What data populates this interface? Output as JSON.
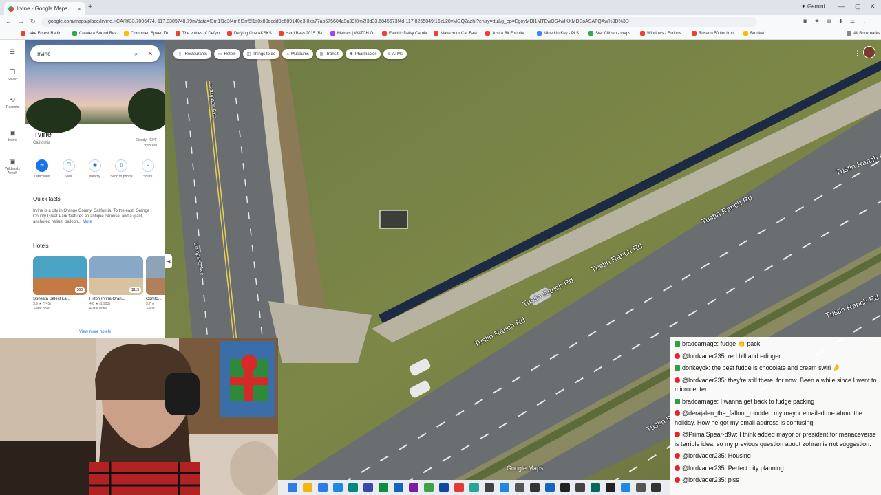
{
  "browser": {
    "tab_title": "Irvine - Google Maps",
    "new_tab_glyph": "+",
    "gemini": "Gemini",
    "url": "google.com/maps/place/Irvine,+CA/@33.7006474,-117.8309748,79m/data=!3m1!1e3!4m6!3m5!1s0x80dcdd0e689140e3:0xa77ab575604a9a39!8m2!3d33.6845673!4d-117.8265049!16zL20vMGQ2azhI?entry=ttu&g_ep=EgoyMDI1MTEwOS4wIKXMDSoASAFQAw%3D%3D",
    "bookmarks": [
      {
        "label": "Lake Forest Radio",
        "color": "#ea4335"
      },
      {
        "label": "Create a Sound Rev...",
        "color": "#34a853"
      },
      {
        "label": "Combined Speed Te...",
        "color": "#fbbc05"
      },
      {
        "label": "The voices of Defyin...",
        "color": "#ea4335"
      },
      {
        "label": "Defying One AKSKS...",
        "color": "#ea4335"
      },
      {
        "label": "Hard Bass 2015 (Bit...",
        "color": "#ea4335"
      },
      {
        "label": "Memes | WATCH O...",
        "color": "#a142f4"
      },
      {
        "label": "Electric Daisy Carniv...",
        "color": "#ea4335"
      },
      {
        "label": "Make Your Car Fast...",
        "color": "#ea4335"
      },
      {
        "label": "Just a Bit Fortnite ...",
        "color": "#ea4335"
      },
      {
        "label": "Mined in Key - Pi S...",
        "color": "#4285f4"
      },
      {
        "label": "Star Citizen - maps",
        "color": "#34a853"
      },
      {
        "label": "Windows - Furious ...",
        "color": "#ea4335"
      },
      {
        "label": "Rosario 50 tim limit...",
        "color": "#ea4335"
      },
      {
        "label": "Brocket",
        "color": "#fbbc05"
      },
      {
        "label": "All Bookmarks",
        "color": "#888888"
      }
    ]
  },
  "rail": {
    "items": [
      {
        "label": "",
        "icon": "menu-icon",
        "glyph": "☰"
      },
      {
        "label": "Saved",
        "icon": "bookmark-icon",
        "glyph": "❐"
      },
      {
        "label": "Recents",
        "icon": "history-icon",
        "glyph": "⟲"
      },
      {
        "label": "Irvine",
        "icon": "place-thumb-icon",
        "glyph": "▣"
      },
      {
        "label": "Wildlands Airsoft",
        "icon": "place-thumb-icon",
        "glyph": "▣"
      }
    ]
  },
  "panel": {
    "search_value": "Irvine",
    "title": "Irvine",
    "subtitle": "California",
    "weather_line1": "Cloudy · 63°F",
    "weather_line2": "9:58 PM",
    "actions": [
      {
        "label": "Directions",
        "icon": "directions-icon",
        "glyph": "➜"
      },
      {
        "label": "Save",
        "icon": "bookmark-icon",
        "glyph": "❐"
      },
      {
        "label": "Nearby",
        "icon": "nearby-icon",
        "glyph": "◉"
      },
      {
        "label": "Send to phone",
        "icon": "phone-icon",
        "glyph": "▯"
      },
      {
        "label": "Share",
        "icon": "share-icon",
        "glyph": "<"
      }
    ],
    "quick_facts_title": "Quick facts",
    "quick_facts_text": "Irvine is a city in Orange County, California. To the east, Orange County Great Park features an antique carousel and a giant, anchored helium balloon...",
    "quick_facts_more": "More",
    "hotels_title": "Hotels",
    "hotels": [
      {
        "name": "Sonesta Select La...",
        "price": "$68",
        "rating": "3.9 ★ (745)",
        "kind": "3-star hotel",
        "color1": "#4aa3c4",
        "color2": "#c47a44"
      },
      {
        "name": "Hilton Irvine/Oran...",
        "price": "$115",
        "rating": "4.0 ★ (1,993)",
        "kind": "4-star hotel",
        "color1": "#87a8c9",
        "color2": "#d9c2a0"
      },
      {
        "name": "Comfo...",
        "price": "",
        "rating": "3.7 ★",
        "kind": "3-star",
        "color1": "#8fa3b8",
        "color2": "#b0805a"
      }
    ],
    "view_more": "View more hotels"
  },
  "map": {
    "chips": [
      {
        "label": "Restaurants",
        "icon": "restaurant-icon",
        "glyph": "🍴"
      },
      {
        "label": "Hotels",
        "icon": "hotel-icon",
        "glyph": "▭"
      },
      {
        "label": "Things to do",
        "icon": "things-icon",
        "glyph": "◫"
      },
      {
        "label": "Museums",
        "icon": "museum-icon",
        "glyph": "⌂"
      },
      {
        "label": "Transit",
        "icon": "transit-icon",
        "glyph": "▤"
      },
      {
        "label": "Pharmacies",
        "icon": "pharmacy-icon",
        "glyph": "✚"
      },
      {
        "label": "ATMs",
        "icon": "atm-icon",
        "glyph": "¤"
      }
    ],
    "road_labels": [
      "Tustin Ranch Rd",
      "Compass Ave"
    ],
    "watermark": "Google Maps"
  },
  "chat": {
    "messages": [
      {
        "badge": "green",
        "user": "bradcarnage",
        "text": "fudge 👏 pack"
      },
      {
        "badge": "red",
        "user": "@lordvader235",
        "text": "red hill and edinger"
      },
      {
        "badge": "green",
        "user": "donkeyok",
        "text": "the best fudge is chocolate and cream swirl 🤌"
      },
      {
        "badge": "red",
        "user": "@lordvader235",
        "text": "they're still there, for now. Been a while since I went to microcenter"
      },
      {
        "badge": "green",
        "user": "bradcarnage",
        "text": "I wanna get back to fudge packing"
      },
      {
        "badge": "red",
        "user": "@derajalen_the_fallout_modder",
        "text": "my mayor emailed me about the holiday. How he got my email address is confusing."
      },
      {
        "badge": "red",
        "user": "@PrimalSpear-d9w",
        "text": "I think added mayor or president for menaceverse is terrible idea, so my previous question about zohran is not suggestion."
      },
      {
        "badge": "red",
        "user": "@lordvader235",
        "text": "Housing"
      },
      {
        "badge": "red",
        "user": "@lordvader235",
        "text": "Perfect city planning"
      },
      {
        "badge": "red",
        "user": "@lordvader235",
        "text": "plss"
      }
    ]
  },
  "colors": {
    "accent": "#1a73e8",
    "grass": "#74803f",
    "road": "#6b6e70"
  }
}
